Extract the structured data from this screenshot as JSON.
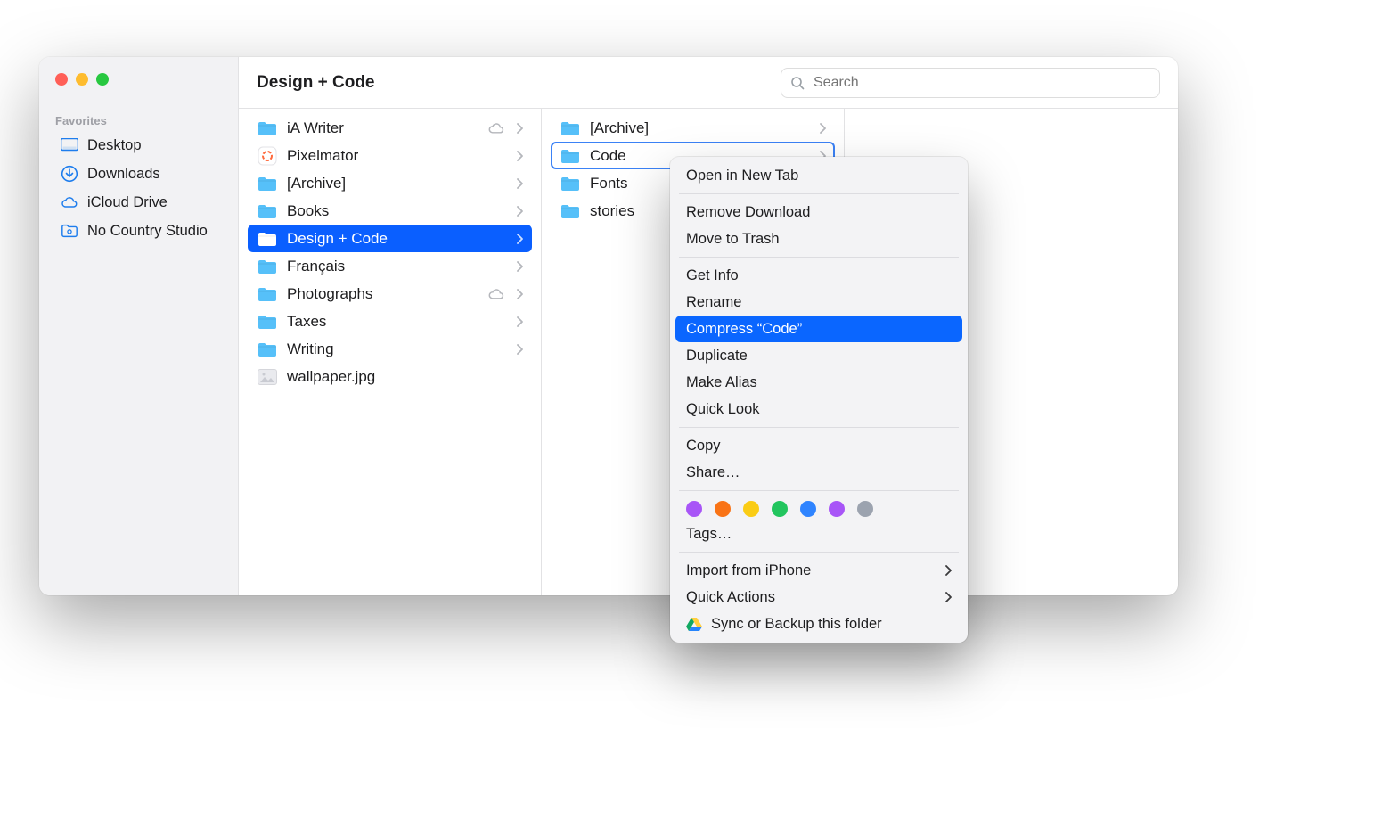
{
  "window": {
    "title": "Design + Code",
    "search_placeholder": "Search"
  },
  "sidebar": {
    "section": "Favorites",
    "items": [
      {
        "label": "Desktop",
        "icon": "desktop"
      },
      {
        "label": "Downloads",
        "icon": "downloads"
      },
      {
        "label": "iCloud Drive",
        "icon": "cloud"
      },
      {
        "label": "No Country Studio",
        "icon": "folder-badge"
      }
    ]
  },
  "columns": [
    {
      "items": [
        {
          "label": "iA Writer",
          "icon": "folder",
          "chevron": true,
          "cloud": true
        },
        {
          "label": "Pixelmator",
          "icon": "app-pixelmator",
          "chevron": true
        },
        {
          "label": "[Archive]",
          "icon": "folder",
          "chevron": true
        },
        {
          "label": "Books",
          "icon": "folder",
          "chevron": true
        },
        {
          "label": "Design + Code",
          "icon": "folder",
          "chevron": true,
          "selected": true
        },
        {
          "label": "Français",
          "icon": "folder",
          "chevron": true
        },
        {
          "label": "Photographs",
          "icon": "folder",
          "chevron": true,
          "cloud": true
        },
        {
          "label": "Taxes",
          "icon": "folder",
          "chevron": true
        },
        {
          "label": "Writing",
          "icon": "folder",
          "chevron": true
        },
        {
          "label": "wallpaper.jpg",
          "icon": "image-file",
          "chevron": false
        }
      ]
    },
    {
      "items": [
        {
          "label": "[Archive]",
          "icon": "folder",
          "chevron": true
        },
        {
          "label": "Code",
          "icon": "folder",
          "chevron": true,
          "focused": true
        },
        {
          "label": "Fonts",
          "icon": "folder",
          "chevron": false
        },
        {
          "label": "stories",
          "icon": "folder",
          "chevron": false
        }
      ]
    },
    {
      "items": []
    }
  ],
  "context_menu": {
    "target": "Code",
    "items": [
      {
        "label": "Open in New Tab"
      },
      {
        "separator": true
      },
      {
        "label": "Remove Download"
      },
      {
        "label": "Move to Trash"
      },
      {
        "separator": true
      },
      {
        "label": "Get Info"
      },
      {
        "label": "Rename"
      },
      {
        "label": "Compress “Code”",
        "highlighted": true
      },
      {
        "label": "Duplicate"
      },
      {
        "label": "Make Alias"
      },
      {
        "label": "Quick Look"
      },
      {
        "separator": true
      },
      {
        "label": "Copy"
      },
      {
        "label": "Share…"
      },
      {
        "separator": true
      },
      {
        "tags": [
          "#a855f7",
          "#f97316",
          "#facc15",
          "#22c55e",
          "#2f84ff",
          "#a855f7",
          "#9ca3af"
        ]
      },
      {
        "label": "Tags…"
      },
      {
        "separator": true
      },
      {
        "label": "Import from iPhone",
        "submenu": true
      },
      {
        "label": "Quick Actions",
        "submenu": true
      },
      {
        "label": "Sync or Backup this folder",
        "icon": "google-drive"
      }
    ]
  }
}
